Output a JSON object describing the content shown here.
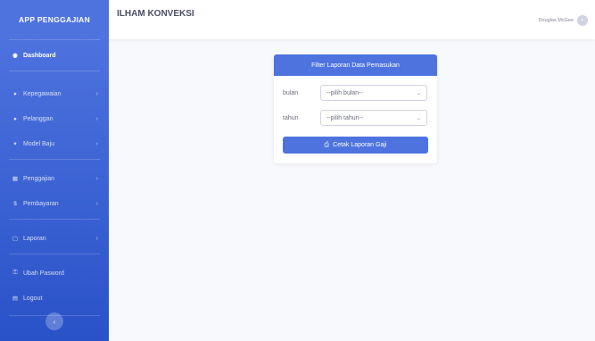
{
  "brand": "APP PENGGAJIAN",
  "app_name": "ILHAM KONVEKSI",
  "user": {
    "name": "Douglas McGee"
  },
  "sidebar": {
    "items": [
      {
        "label": "Dashboard",
        "icon": "tachometer-icon"
      },
      {
        "label": "Kepegawaian",
        "icon": "user-icon"
      },
      {
        "label": "Pelanggan",
        "icon": "users-icon"
      },
      {
        "label": "Model Baju",
        "icon": "shirt-icon"
      },
      {
        "label": "Penggajian",
        "icon": "table-icon"
      },
      {
        "label": "Pembayaran",
        "icon": "dollar-icon"
      },
      {
        "label": "Laporan",
        "icon": "file-icon"
      },
      {
        "label": "Ubah Pasword",
        "icon": "key-icon"
      },
      {
        "label": "Logout",
        "icon": "logout-icon"
      }
    ]
  },
  "card": {
    "title": "Filter Laporan Data Pemasukan",
    "bulan_label": "bulan",
    "bulan_value": "--pilih bulan--",
    "tahun_label": "tahun",
    "tahun_value": "--pilih tahun--",
    "button_label": "Cetak Laporan Gaji"
  },
  "colors": {
    "primary": "#4e73df",
    "background": "#f8f9fc"
  }
}
